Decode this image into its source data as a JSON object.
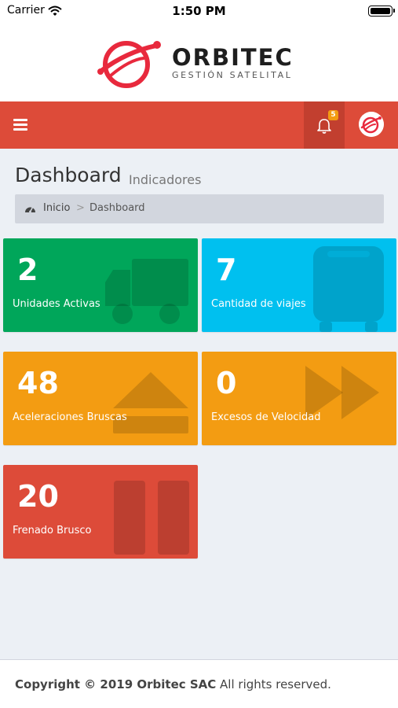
{
  "status_bar": {
    "carrier": "Carrier",
    "time": "1:50 PM"
  },
  "brand": {
    "name": "ORBITEC",
    "tagline": "GESTIÓN SATELITAL",
    "accent_color": "#dd4b39"
  },
  "navbar": {
    "menu_icon": "hamburger-menu-icon",
    "notification_count": "5",
    "notification_icon": "bell-icon",
    "user_icon": "orbitec-avatar"
  },
  "header": {
    "title": "Dashboard",
    "subtitle": "Indicadores"
  },
  "breadcrumb": {
    "icon": "dashboard-gauge-icon",
    "home": "Inicio",
    "separator": ">",
    "current": "Dashboard"
  },
  "boxes": [
    {
      "value": "2",
      "label": "Unidades Activas",
      "color": "#00a65a",
      "icon": "truck-icon"
    },
    {
      "value": "7",
      "label": "Cantidad de viajes",
      "color": "#00c0ef",
      "icon": "bus-icon"
    },
    {
      "value": "48",
      "label": "Aceleraciones Bruscas",
      "color": "#f39c12",
      "icon": "eject-icon"
    },
    {
      "value": "0",
      "label": "Excesos de Velocidad",
      "color": "#f39c12",
      "icon": "fast-forward-icon"
    },
    {
      "value": "20",
      "label": "Frenado Brusco",
      "color": "#dd4b39",
      "icon": "pause-icon"
    }
  ],
  "footer": {
    "copyright": "Copyright © 2019 Orbitec SAC",
    "rights": " All rights reserved."
  }
}
